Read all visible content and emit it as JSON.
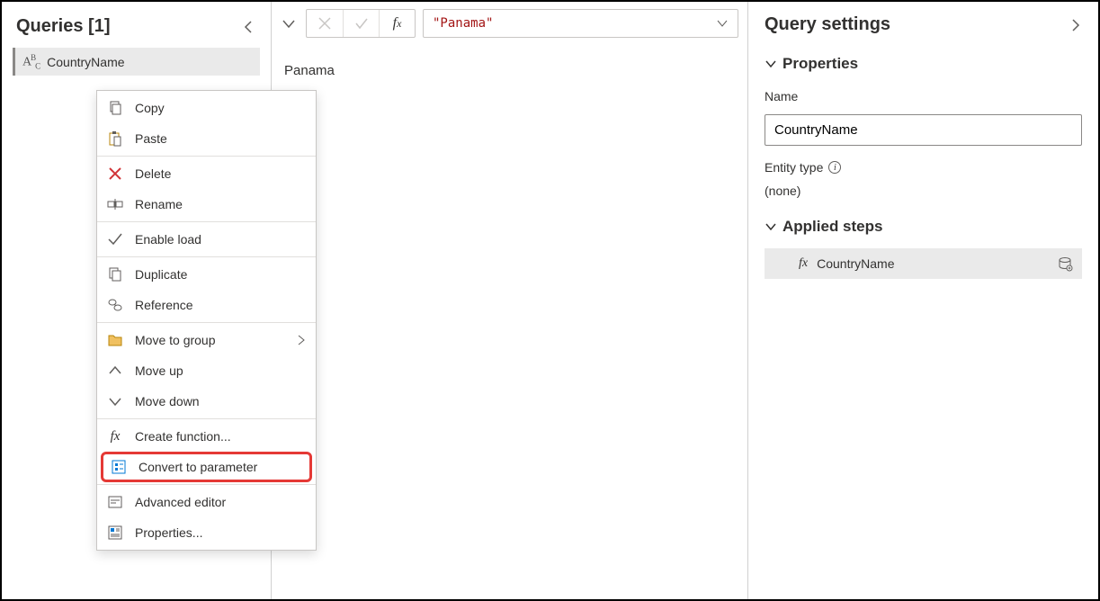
{
  "left": {
    "title": "Queries [1]",
    "query_name": "CountryName"
  },
  "context_menu": {
    "copy": "Copy",
    "paste": "Paste",
    "delete": "Delete",
    "rename": "Rename",
    "enable_load": "Enable load",
    "duplicate": "Duplicate",
    "reference": "Reference",
    "move_to_group": "Move to group",
    "move_up": "Move up",
    "move_down": "Move down",
    "create_function": "Create function...",
    "convert_to_parameter": "Convert to parameter",
    "advanced_editor": "Advanced editor",
    "properties": "Properties..."
  },
  "formula": {
    "expression": "\"Panama\""
  },
  "result": {
    "value": "Panama"
  },
  "right": {
    "title": "Query settings",
    "properties_section": "Properties",
    "name_label": "Name",
    "name_value": "CountryName",
    "entity_type_label": "Entity type",
    "entity_type_value": "(none)",
    "applied_steps_section": "Applied steps",
    "step1": "CountryName"
  }
}
